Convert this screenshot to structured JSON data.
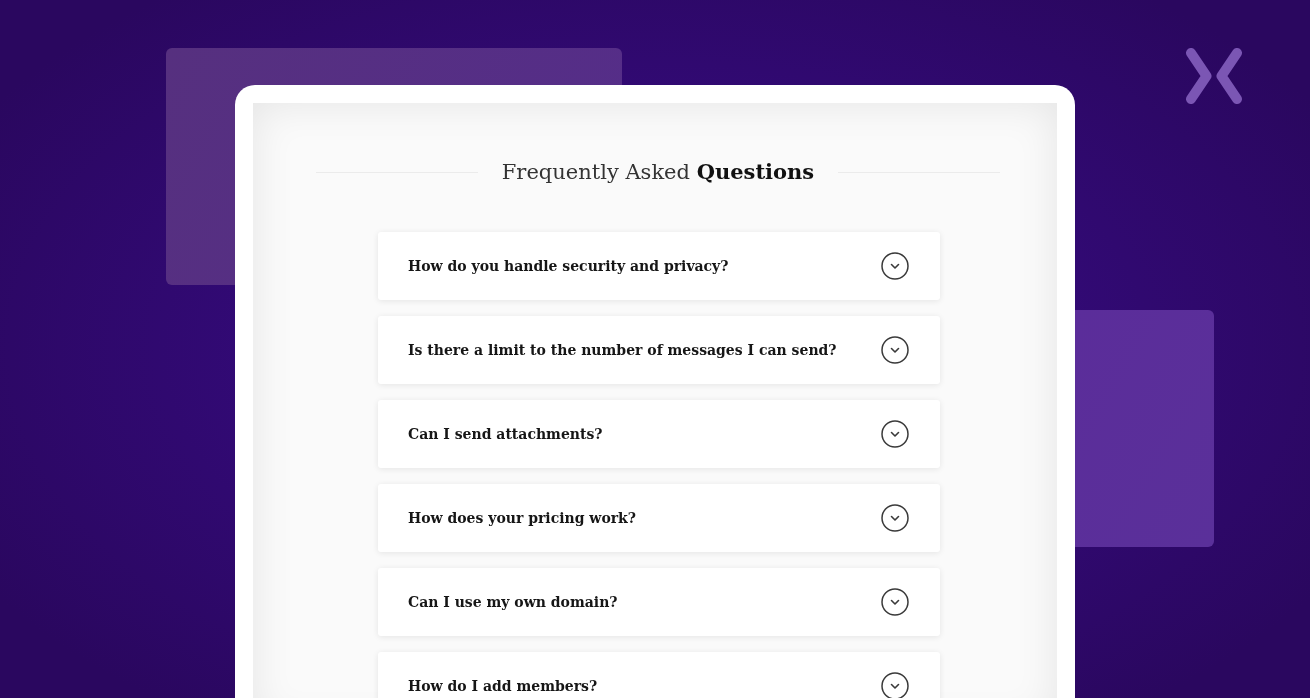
{
  "faq": {
    "title": "Frequently Asked **Questions**",
    "items": [
      {
        "question": "How do you handle security and privacy?",
        "expanded": false
      },
      {
        "question": "Is there a limit to the number of messages I can send?",
        "expanded": false
      },
      {
        "question": "Can I send attachments?",
        "expanded": false
      },
      {
        "question": "How does your pricing work?",
        "expanded": false
      },
      {
        "question": "Can I use my own domain?",
        "expanded": false
      },
      {
        "question": "How do I add members?",
        "expanded": false
      }
    ]
  }
}
